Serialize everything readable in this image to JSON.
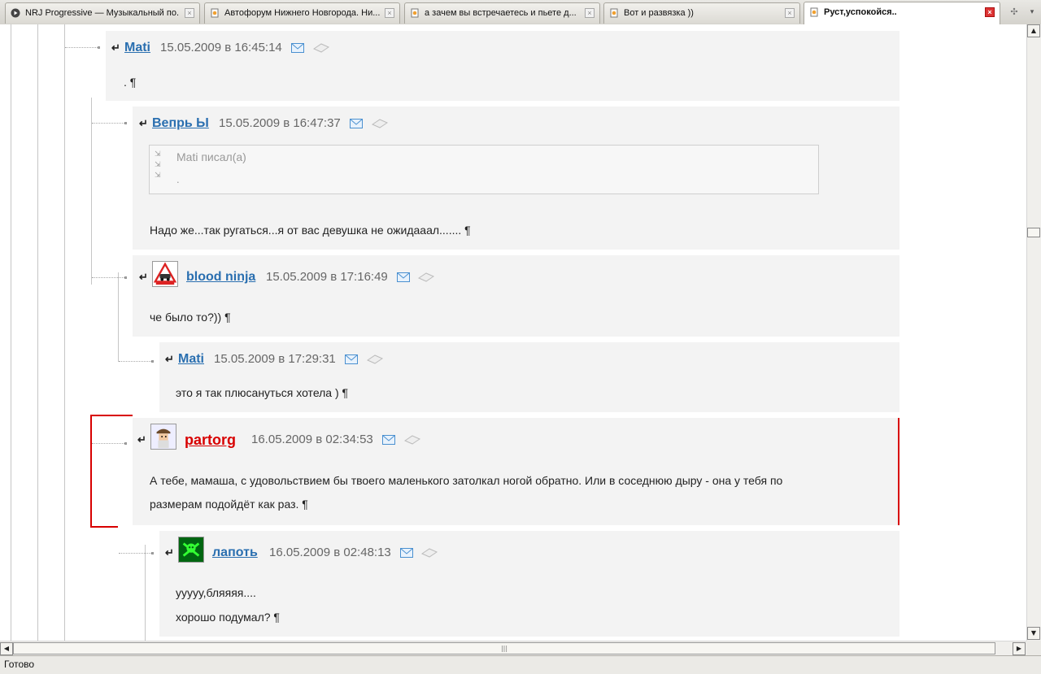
{
  "tabs": [
    {
      "label": "NRJ Progressive — Музыкальный по...",
      "icon": "play-icon",
      "active": false
    },
    {
      "label": "Автофорум Нижнего Новгорода. Ни...",
      "icon": "page-icon",
      "active": false
    },
    {
      "label": "а зачем вы встречаетесь и пьете д...",
      "icon": "page-icon",
      "active": false
    },
    {
      "label": "Вот и развязка ))",
      "icon": "page-icon",
      "active": false
    },
    {
      "label": "Руст,успокойся..",
      "icon": "page-icon",
      "active": true
    }
  ],
  "comments": [
    {
      "author": "Mati",
      "time": "15.05.2009 в 16:45:14",
      "lines": [
        ". ¶"
      ]
    },
    {
      "author": "Вепрь Ы",
      "time": "15.05.2009 в 16:47:37",
      "quote": {
        "author": "Mati писал(а)",
        "text": "."
      },
      "lines": [
        "Надо же...так ругаться...я от вас девушка не ожидааал....... ¶"
      ]
    },
    {
      "author": "blood ninja",
      "time": "15.05.2009 в 17:16:49",
      "lines": [
        "че было то?)) ¶"
      ]
    },
    {
      "author": "Mati",
      "time": "15.05.2009 в 17:29:31",
      "lines": [
        "это я так плюсануться хотела ) ¶"
      ]
    },
    {
      "author": "partorg",
      "time": "16.05.2009 в 02:34:53",
      "lines": [
        "А тебе, мамаша, с удовольствием бы твоего маленького затолкал ногой обратно. Или в соседнюю дыру - она у тебя по",
        "размерам подойдёт как раз. ¶"
      ]
    },
    {
      "author": "лапоть",
      "time": "16.05.2009 в 02:48:13",
      "lines": [
        "ууууу,бляяяя....",
        "хорошо подумал? ¶"
      ]
    }
  ],
  "status": {
    "text": "Готово"
  },
  "colors": {
    "link": "#2a6fb0",
    "highlight": "#d80000",
    "comment_bg": "#f3f3f3"
  }
}
